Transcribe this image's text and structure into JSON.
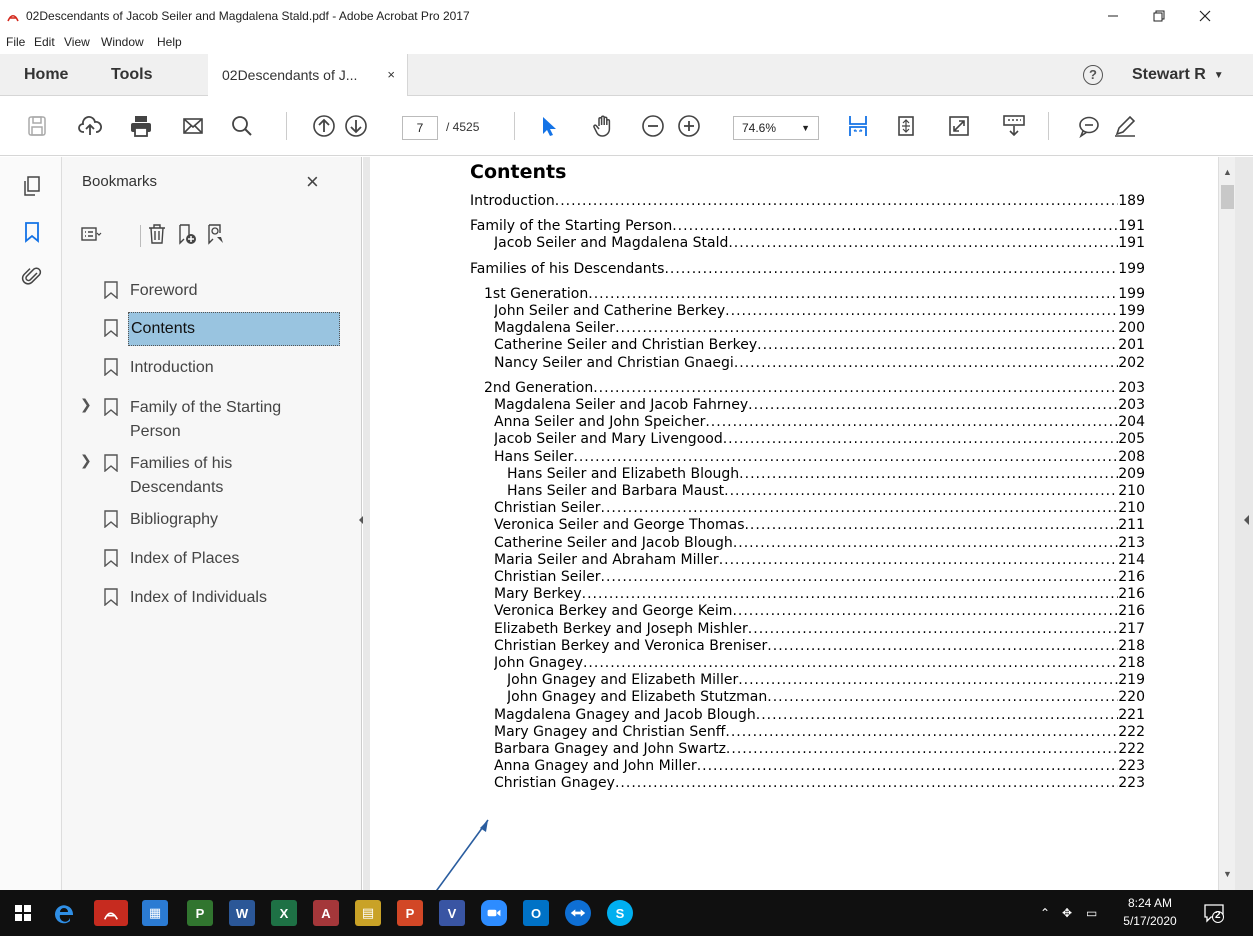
{
  "window": {
    "title": "02Descendants of Jacob Seiler and Magdalena Stald.pdf - Adobe Acrobat Pro 2017"
  },
  "menu": [
    "File",
    "Edit",
    "View",
    "Window",
    "Help"
  ],
  "tabs": {
    "home": "Home",
    "tools": "Tools",
    "document": "02Descendants of J...",
    "close": "×"
  },
  "help": "?",
  "user": "Stewart R",
  "toolbar": {
    "page_current": "7",
    "page_total": "/ 4525",
    "zoom": "74.6%"
  },
  "bookmarks": {
    "title": "Bookmarks",
    "close": "×",
    "items": [
      {
        "label": "Foreword",
        "expandable": false,
        "selected": false
      },
      {
        "label": "Contents",
        "expandable": false,
        "selected": true
      },
      {
        "label": "Introduction",
        "expandable": false,
        "selected": false
      },
      {
        "label": "Family of the Starting Person",
        "expandable": true,
        "selected": false
      },
      {
        "label": "Families of his Descendants",
        "expandable": true,
        "selected": false
      },
      {
        "label": "Bibliography",
        "expandable": false,
        "selected": false
      },
      {
        "label": "Index of Places",
        "expandable": false,
        "selected": false
      },
      {
        "label": "Index of Individuals",
        "expandable": false,
        "selected": false
      }
    ]
  },
  "document": {
    "heading": "Contents",
    "toc": [
      {
        "text": "Introduction",
        "page": "189",
        "indent": 0,
        "gap": true
      },
      {
        "text": "Family of the Starting Person ",
        "page": "191",
        "indent": 0,
        "gap": true
      },
      {
        "text": "Jacob Seiler and Magdalena Stald ",
        "page": "191",
        "indent": 2,
        "gap": false
      },
      {
        "text": "Families of his Descendants ",
        "page": "199",
        "indent": 0,
        "gap": true
      },
      {
        "text": "1st Generation ",
        "page": "199",
        "indent": 1,
        "gap": true
      },
      {
        "text": "John Seiler and Catherine Berkey ",
        "page": "199",
        "indent": 2,
        "gap": false
      },
      {
        "text": "Magdalena Seiler",
        "page": "200",
        "indent": 2,
        "gap": false
      },
      {
        "text": "Catherine Seiler and Christian Berkey ",
        "page": "201",
        "indent": 2,
        "gap": false
      },
      {
        "text": "Nancy Seiler and Christian Gnaegi ",
        "page": "202",
        "indent": 2,
        "gap": false
      },
      {
        "text": "2nd Generation ",
        "page": "203",
        "indent": 1,
        "gap": true
      },
      {
        "text": "Magdalena Seiler and Jacob Fahrney",
        "page": "203",
        "indent": 2,
        "gap": false
      },
      {
        "text": "Anna Seiler and John Speicher ",
        "page": "204",
        "indent": 2,
        "gap": false
      },
      {
        "text": "Jacob Seiler and Mary Livengood ",
        "page": "205",
        "indent": 2,
        "gap": false
      },
      {
        "text": "Hans Seiler",
        "page": "208",
        "indent": 2,
        "gap": false
      },
      {
        "text": "Hans Seiler and Elizabeth Blough",
        "page": "209",
        "indent": 3,
        "gap": false
      },
      {
        "text": "Hans Seiler and Barbara Maust ",
        "page": "210",
        "indent": 3,
        "gap": false
      },
      {
        "text": "Christian Seiler ",
        "page": "210",
        "indent": 2,
        "gap": false
      },
      {
        "text": "Veronica Seiler and George Thomas",
        "page": "211",
        "indent": 2,
        "gap": false
      },
      {
        "text": "Catherine Seiler and Jacob Blough ",
        "page": "213",
        "indent": 2,
        "gap": false
      },
      {
        "text": "Maria Seiler and Abraham Miller ",
        "page": "214",
        "indent": 2,
        "gap": false
      },
      {
        "text": "Christian Seiler ",
        "page": "216",
        "indent": 2,
        "gap": false
      },
      {
        "text": "Mary Berkey ",
        "page": "216",
        "indent": 2,
        "gap": false
      },
      {
        "text": "Veronica Berkey and George Keim",
        "page": "216",
        "indent": 2,
        "gap": false
      },
      {
        "text": "Elizabeth Berkey and Joseph Mishler ",
        "page": "217",
        "indent": 2,
        "gap": false
      },
      {
        "text": "Christian Berkey and Veronica Breniser ",
        "page": "218",
        "indent": 2,
        "gap": false
      },
      {
        "text": "John Gnagey",
        "page": "218",
        "indent": 2,
        "gap": false
      },
      {
        "text": "John Gnagey and Elizabeth Miller",
        "page": "219",
        "indent": 3,
        "gap": false
      },
      {
        "text": "John Gnagey and Elizabeth Stutzman",
        "page": "220",
        "indent": 3,
        "gap": false
      },
      {
        "text": "Magdalena Gnagey and Jacob Blough",
        "page": "221",
        "indent": 2,
        "gap": false
      },
      {
        "text": "Mary Gnagey and Christian Senff",
        "page": "222",
        "indent": 2,
        "gap": false
      },
      {
        "text": "Barbara Gnagey and John Swartz ",
        "page": "222",
        "indent": 2,
        "gap": false
      },
      {
        "text": "Anna Gnagey and John Miller ",
        "page": "223",
        "indent": 2,
        "gap": false
      },
      {
        "text": "Christian Gnagey",
        "page": "223",
        "indent": 2,
        "gap": false
      }
    ]
  },
  "taskbar": {
    "time": "8:24 AM",
    "date": "5/17/2020",
    "notifications": "2",
    "apps": [
      "windows-start",
      "edge",
      "acrobat",
      "outlook-contacts",
      "project",
      "word",
      "excel",
      "access",
      "publisher-alt",
      "powerpoint",
      "visio",
      "zoom",
      "outlook",
      "teamviewer",
      "skype"
    ]
  },
  "colors": {
    "selection": "#99c4e0",
    "accent": "#1473e6",
    "taskbar": "#101010"
  }
}
